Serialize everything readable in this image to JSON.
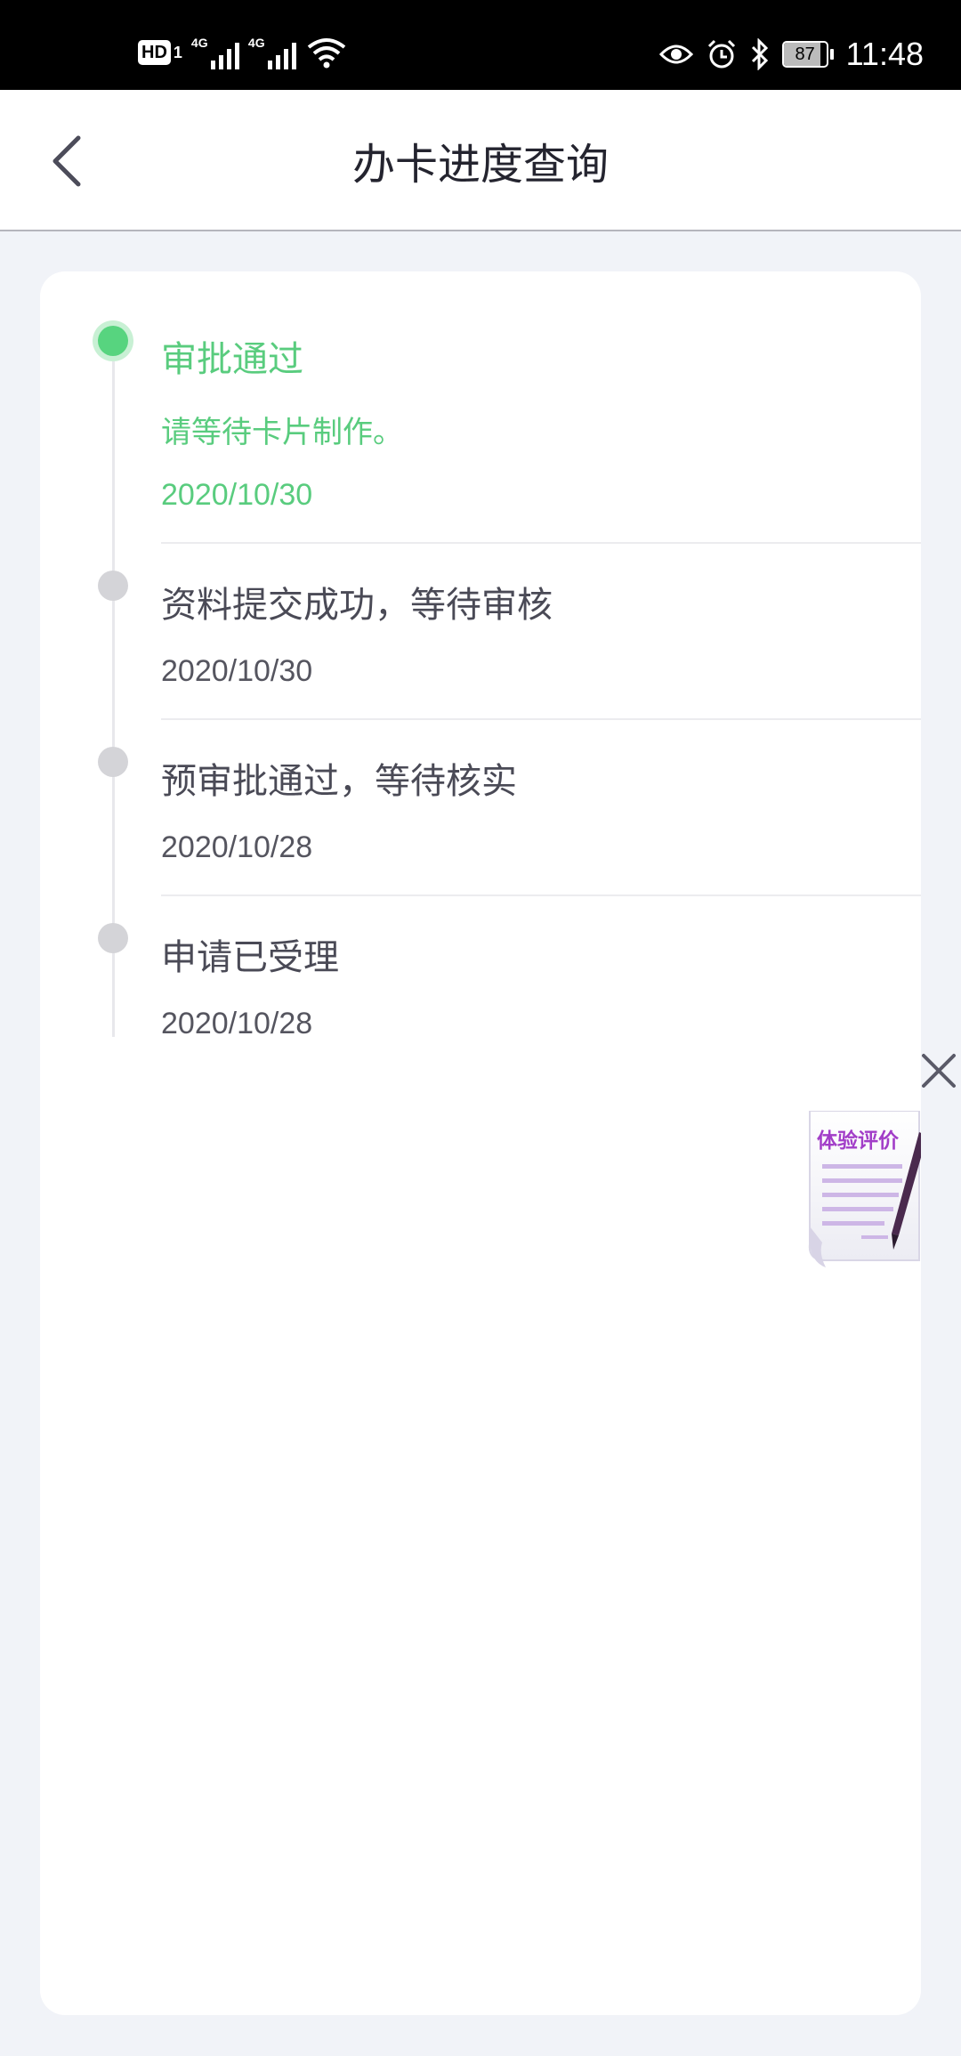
{
  "status_bar": {
    "hd_label": "HD",
    "hd_sub": "1",
    "network1": "4G",
    "network2": "4G",
    "battery_level": "87",
    "battery_fraction": 0.87,
    "time": "11:48",
    "icons": [
      "hd-icon",
      "signal-icon",
      "signal-icon",
      "wifi-icon",
      "eye-icon",
      "alarm-icon",
      "bluetooth-icon",
      "battery-icon"
    ]
  },
  "nav": {
    "back_icon": "chevron-left-icon",
    "title": "办卡进度查询"
  },
  "timeline": [
    {
      "title": "审批通过",
      "desc": "请等待卡片制作。",
      "date": "2020/10/30",
      "active": true
    },
    {
      "title": "资料提交成功，等待审核",
      "desc": "",
      "date": "2020/10/30",
      "active": false
    },
    {
      "title": "预审批通过，等待核实",
      "desc": "",
      "date": "2020/10/28",
      "active": false
    },
    {
      "title": "申请已受理",
      "desc": "",
      "date": "2020/10/28",
      "active": false
    }
  ],
  "float_widget": {
    "close_icon": "close-icon",
    "feedback_label": "体验评价",
    "feedback_icon": "document-pen-icon"
  },
  "colors": {
    "accent_green": "#59cc7e",
    "dot_inactive": "#d4d4d8",
    "background": "#f1f3f8",
    "feedback_purple": "#a23ec8"
  }
}
